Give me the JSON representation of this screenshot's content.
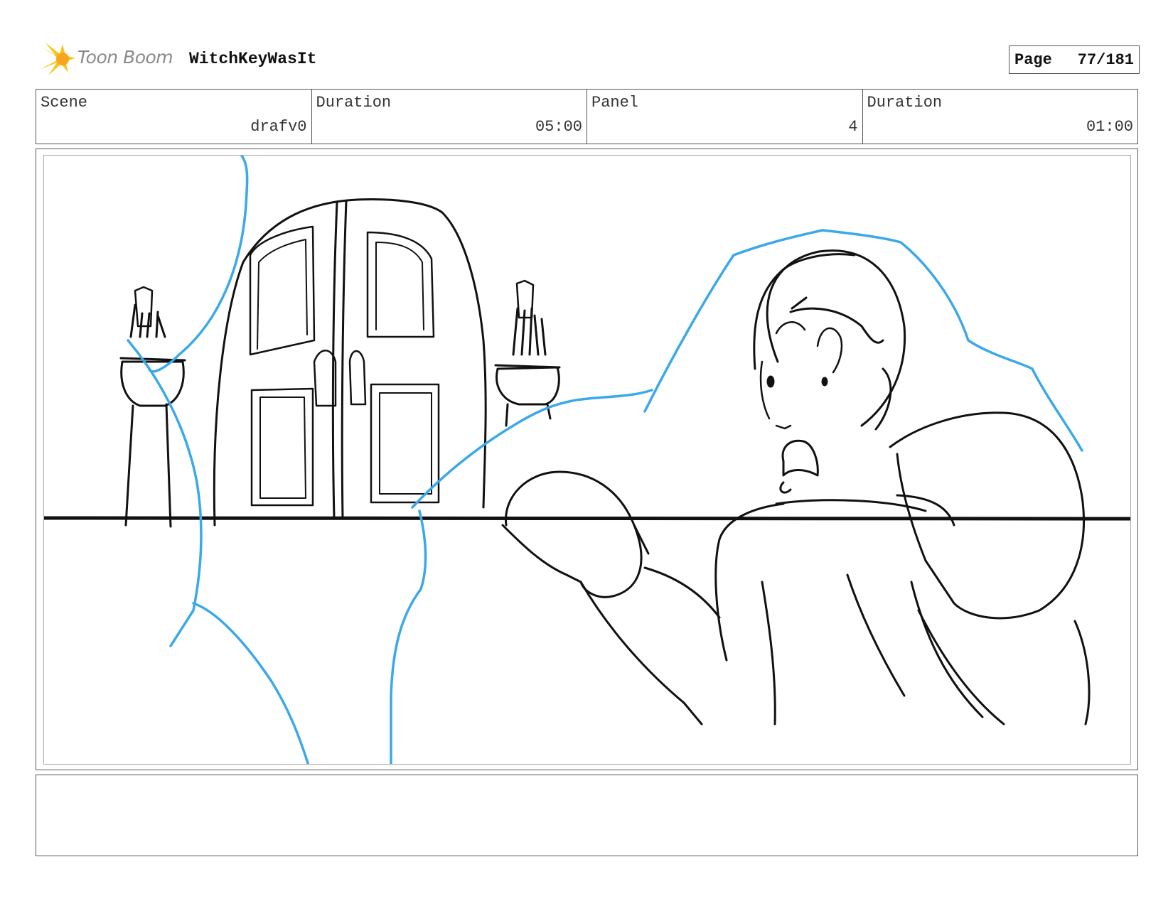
{
  "header": {
    "logo_text": "Toon Boom",
    "project_title": "WitchKeyWasIt",
    "page_label": "Page",
    "page_value": "77/181"
  },
  "info": {
    "scene_label": "Scene",
    "scene_value": "drafv0",
    "scene_duration_label": "Duration",
    "scene_duration_value": "05:00",
    "panel_label": "Panel",
    "panel_value": "4",
    "panel_duration_label": "Duration",
    "panel_duration_value": "01:00"
  },
  "colors": {
    "logo_star": "#f5c518",
    "sketch_black": "#111111",
    "sketch_blue": "#3ba8e8"
  },
  "notes": {
    "text": ""
  }
}
